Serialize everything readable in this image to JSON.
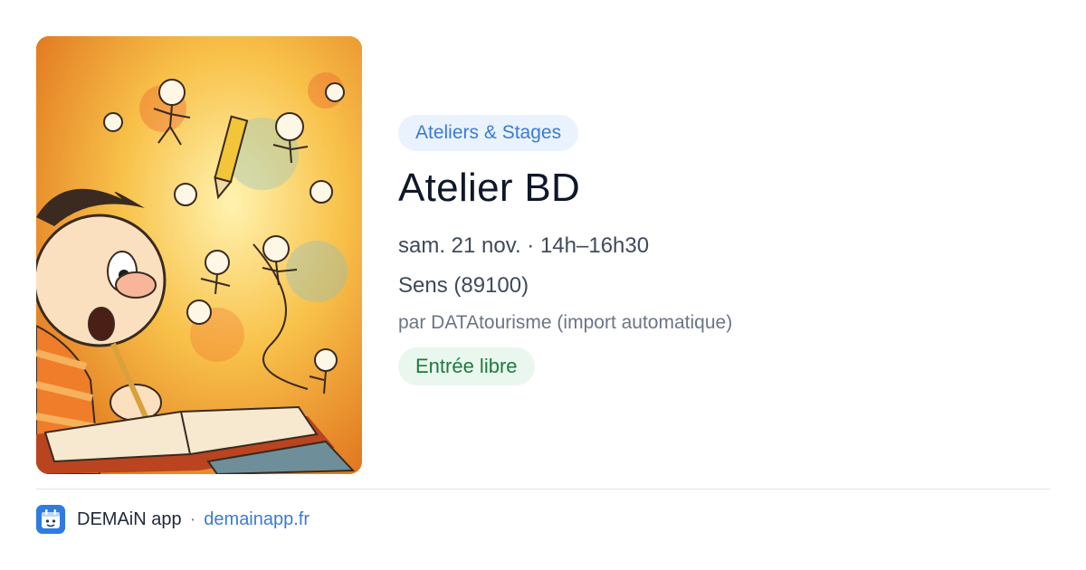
{
  "event": {
    "image_alt": "Illustration: child drawing comic characters in a sketchbook",
    "category": "Ateliers & Stages",
    "title": "Atelier BD",
    "date": "sam. 21 nov. · 14h–16h30",
    "location": "Sens (89100)",
    "source": "par DATAtourisme (import automatique)",
    "price": "Entrée libre"
  },
  "footer": {
    "app_name": "DEMAiN app",
    "separator": "·",
    "url": "demainapp.fr",
    "logo_icon": "demain-app-logo-icon"
  },
  "colors": {
    "category_bg": "#eaf2fd",
    "category_text": "#3a7bd5",
    "price_bg": "#e9f7ee",
    "price_text": "#1f7a3e",
    "link": "#3a7bd5"
  }
}
